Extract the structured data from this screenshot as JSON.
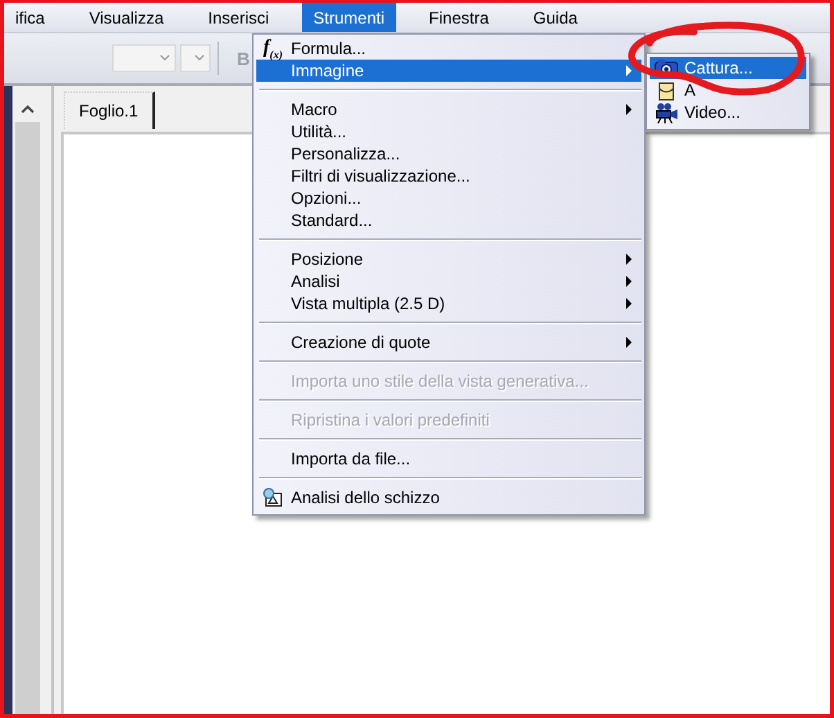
{
  "menubar": [
    {
      "label": "ifica",
      "selected": false
    },
    {
      "label": "Visualizza",
      "selected": false
    },
    {
      "label": "Inserisci",
      "selected": false
    },
    {
      "label": "Strumenti",
      "selected": true
    },
    {
      "label": "Finestra",
      "selected": false
    },
    {
      "label": "Guida",
      "selected": false
    }
  ],
  "toolbar": {
    "bold_button": "B"
  },
  "sheet_tab": {
    "label": "Foglio.1"
  },
  "menu": {
    "items": [
      {
        "kind": "item",
        "label": "Formula...",
        "glyph": "f$_{(x)}$",
        "selected": false,
        "disabled": false,
        "submenu": false
      },
      {
        "kind": "item",
        "label": "Immagine",
        "selected": true,
        "disabled": false,
        "submenu": true
      },
      {
        "kind": "separator"
      },
      {
        "kind": "item",
        "label": "Macro",
        "selected": false,
        "disabled": false,
        "submenu": true
      },
      {
        "kind": "item",
        "label": "Utilità...",
        "selected": false,
        "disabled": false,
        "submenu": false
      },
      {
        "kind": "item",
        "label": "Personalizza...",
        "selected": false,
        "disabled": false,
        "submenu": false
      },
      {
        "kind": "item",
        "label": "Filtri di visualizzazione...",
        "selected": false,
        "disabled": false,
        "submenu": false
      },
      {
        "kind": "item",
        "label": "Opzioni...",
        "selected": false,
        "disabled": false,
        "submenu": false
      },
      {
        "kind": "item",
        "label": "Standard...",
        "selected": false,
        "disabled": false,
        "submenu": false
      },
      {
        "kind": "separator"
      },
      {
        "kind": "item",
        "label": "Posizione",
        "selected": false,
        "disabled": false,
        "submenu": true
      },
      {
        "kind": "item",
        "label": "Analisi",
        "selected": false,
        "disabled": false,
        "submenu": true
      },
      {
        "kind": "item",
        "label": "Vista multipla (2.5 D)",
        "selected": false,
        "disabled": false,
        "submenu": true
      },
      {
        "kind": "separator"
      },
      {
        "kind": "item",
        "label": "Creazione di quote",
        "selected": false,
        "disabled": false,
        "submenu": true
      },
      {
        "kind": "separator"
      },
      {
        "kind": "item",
        "label": "Importa uno stile della vista generativa...",
        "selected": false,
        "disabled": true,
        "submenu": false
      },
      {
        "kind": "separator"
      },
      {
        "kind": "item",
        "label": "Ripristina i valori predefiniti",
        "selected": false,
        "disabled": true,
        "submenu": false
      },
      {
        "kind": "separator"
      },
      {
        "kind": "item",
        "label": "Importa da file...",
        "selected": false,
        "disabled": false,
        "submenu": false
      },
      {
        "kind": "separator"
      },
      {
        "kind": "item",
        "label": "Analisi dello schizzo",
        "selected": false,
        "disabled": false,
        "submenu": false
      }
    ]
  },
  "submenu": {
    "items": [
      {
        "kind": "item",
        "label": "Cattura...",
        "selected": true,
        "disabled": false,
        "submenu": false
      },
      {
        "kind": "item",
        "label": "A",
        "selected": false,
        "disabled": false,
        "submenu": false
      },
      {
        "kind": "item",
        "label": "Video...",
        "selected": false,
        "disabled": false,
        "submenu": false
      }
    ]
  }
}
